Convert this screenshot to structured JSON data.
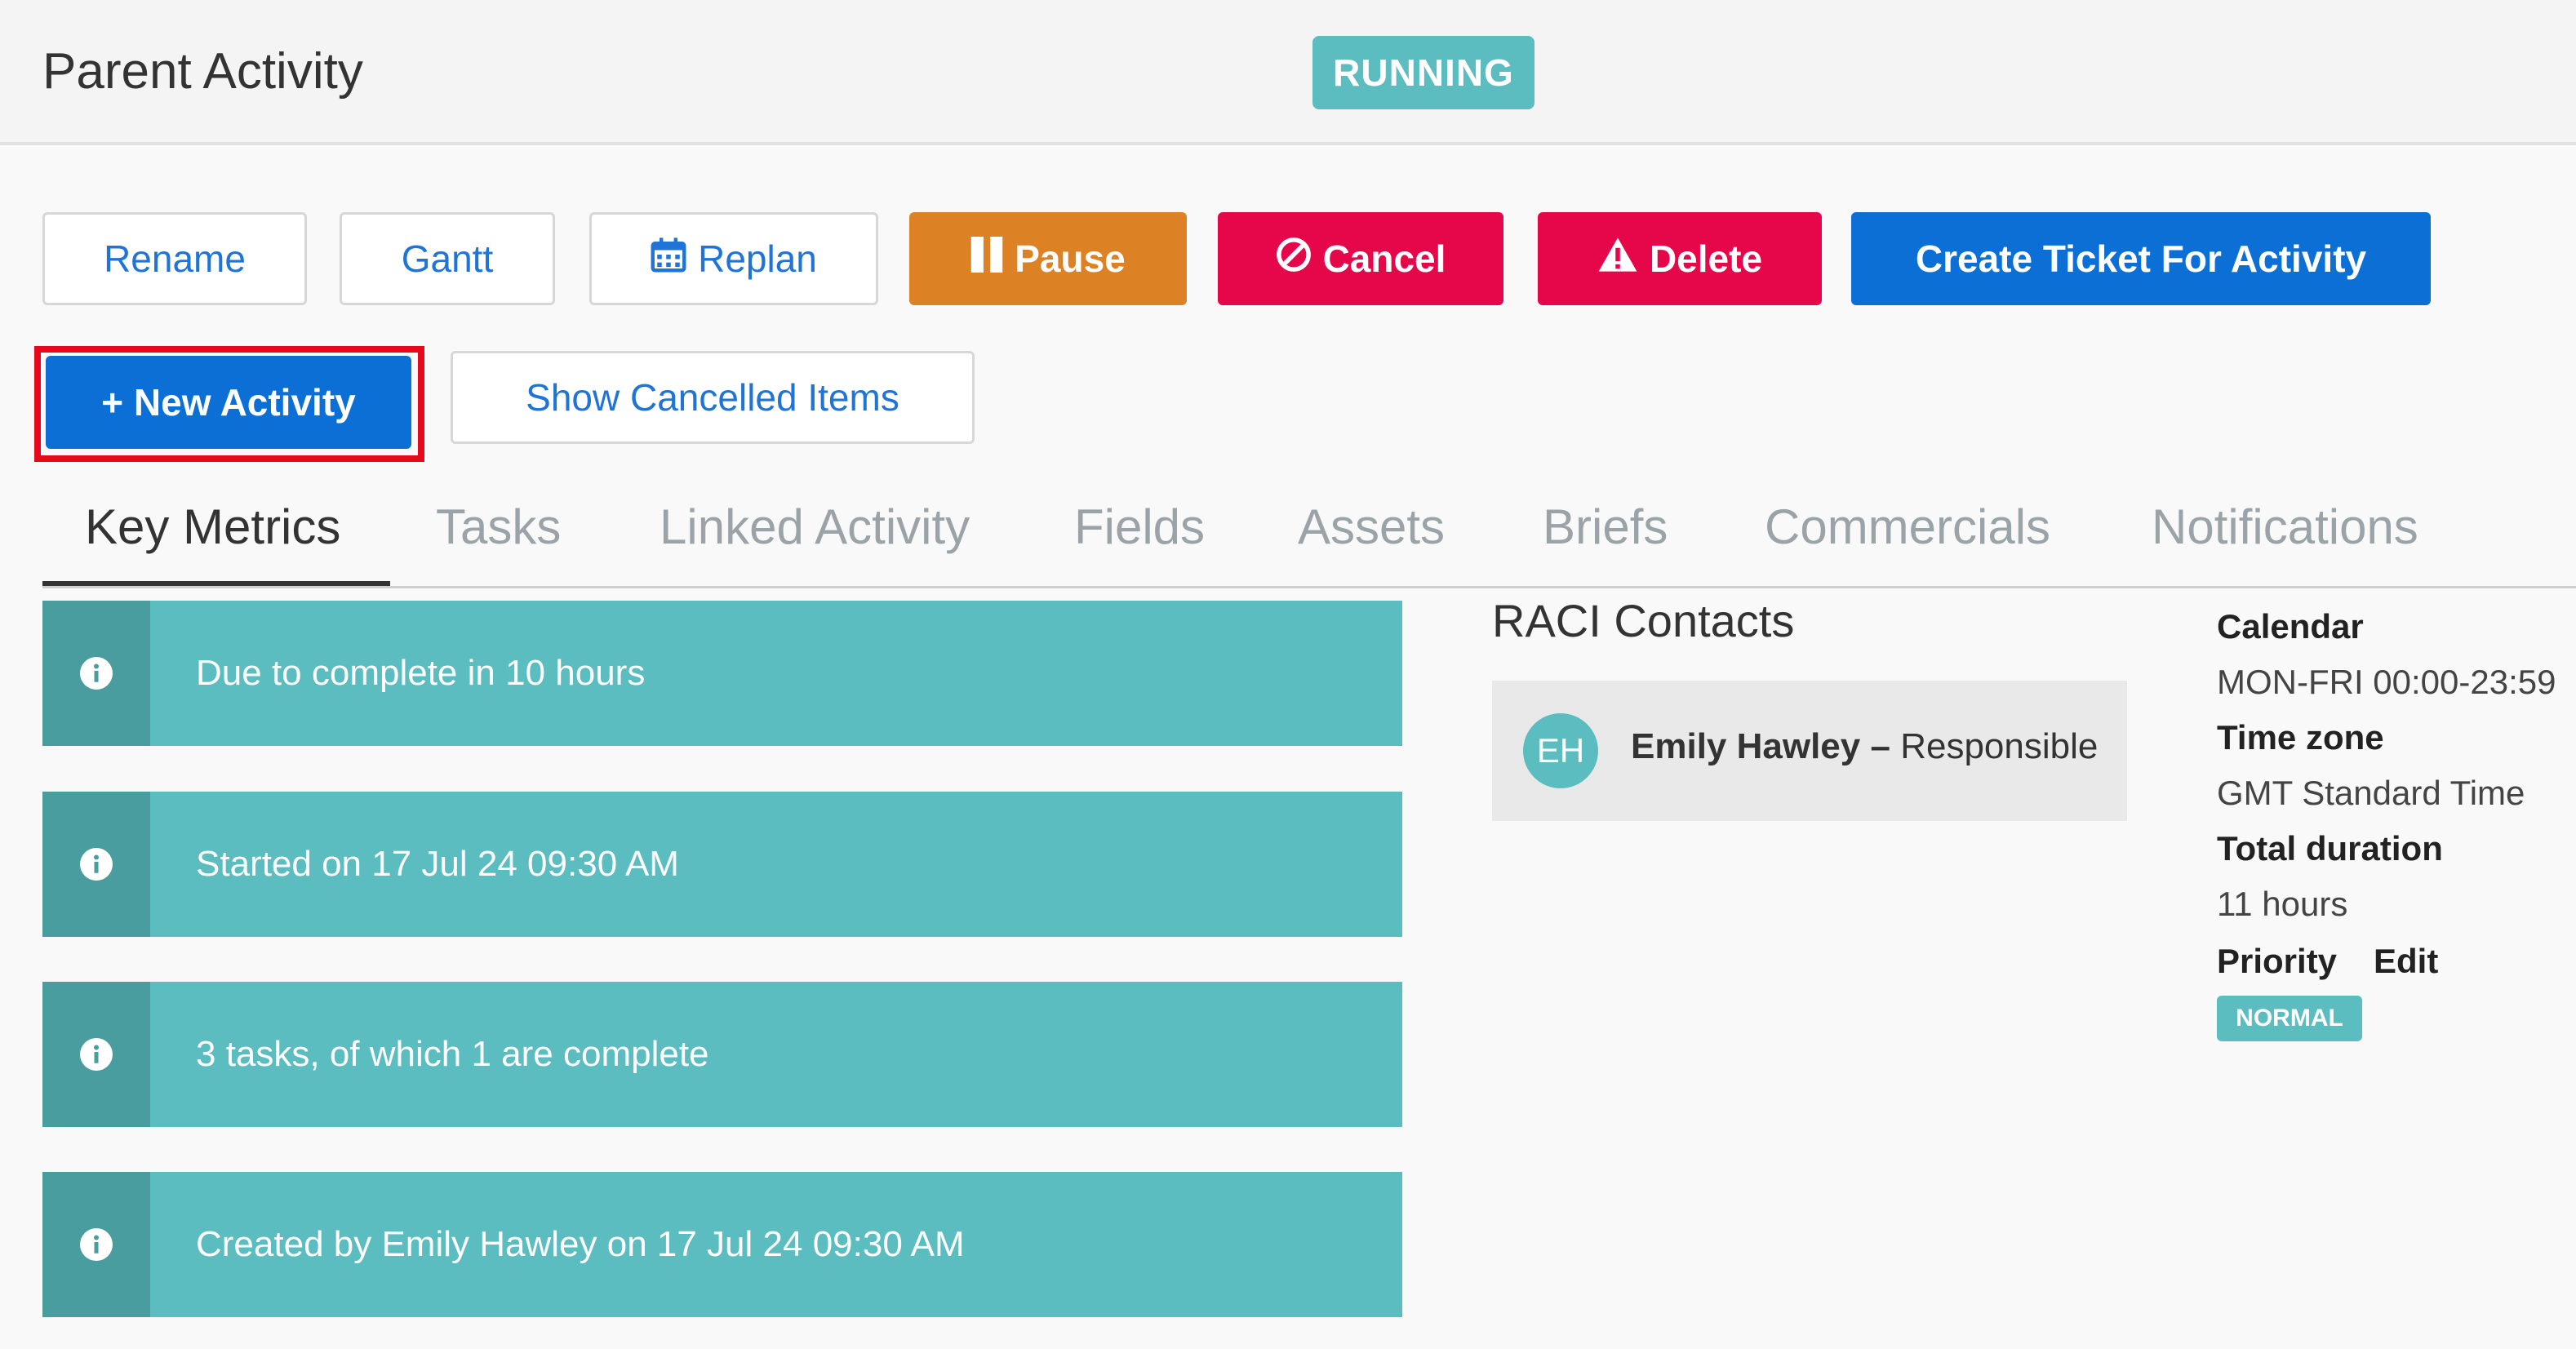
{
  "header": {
    "title": "Parent Activity",
    "status": "RUNNING"
  },
  "toolbar": {
    "rename": "Rename",
    "gantt": "Gantt",
    "replan": "Replan",
    "pause": "Pause",
    "cancel": "Cancel",
    "delete": "Delete",
    "create_ticket": "Create Ticket For Activity",
    "new_activity": "+ New Activity",
    "show_cancelled": "Show Cancelled Items"
  },
  "tabs": [
    {
      "label": "Key Metrics",
      "active": true
    },
    {
      "label": "Tasks"
    },
    {
      "label": "Linked Activity"
    },
    {
      "label": "Fields"
    },
    {
      "label": "Assets"
    },
    {
      "label": "Briefs"
    },
    {
      "label": "Commercials"
    },
    {
      "label": "Notifications"
    }
  ],
  "metrics": [
    "Due to complete in 10 hours",
    "Started on 17 Jul 24 09:30 AM",
    "3 tasks, of which 1 are complete",
    "Created by Emily Hawley on 17 Jul 24 09:30 AM"
  ],
  "raci": {
    "title": "RACI Contacts",
    "initials": "EH",
    "name": "Emily Hawley",
    "role": "Responsible"
  },
  "details": {
    "calendar_label": "Calendar",
    "calendar_value": "MON-FRI 00:00-23:59",
    "timezone_label": "Time zone",
    "timezone_value": "GMT Standard Time",
    "duration_label": "Total duration",
    "duration_value": "11 hours",
    "priority_label": "Priority",
    "priority_edit": "Edit",
    "priority_value": "NORMAL"
  },
  "colors": {
    "teal": "#5bbdc0",
    "teal_dark": "#4a9d9e",
    "orange": "#dd8125",
    "red": "#e5074a",
    "blue": "#0c6fd6",
    "highlight": "#e8081c"
  },
  "icons": {
    "replan": "calendar-icon",
    "pause": "pause-icon",
    "cancel": "ban-icon",
    "delete": "warning-icon",
    "metric": "info-icon"
  }
}
